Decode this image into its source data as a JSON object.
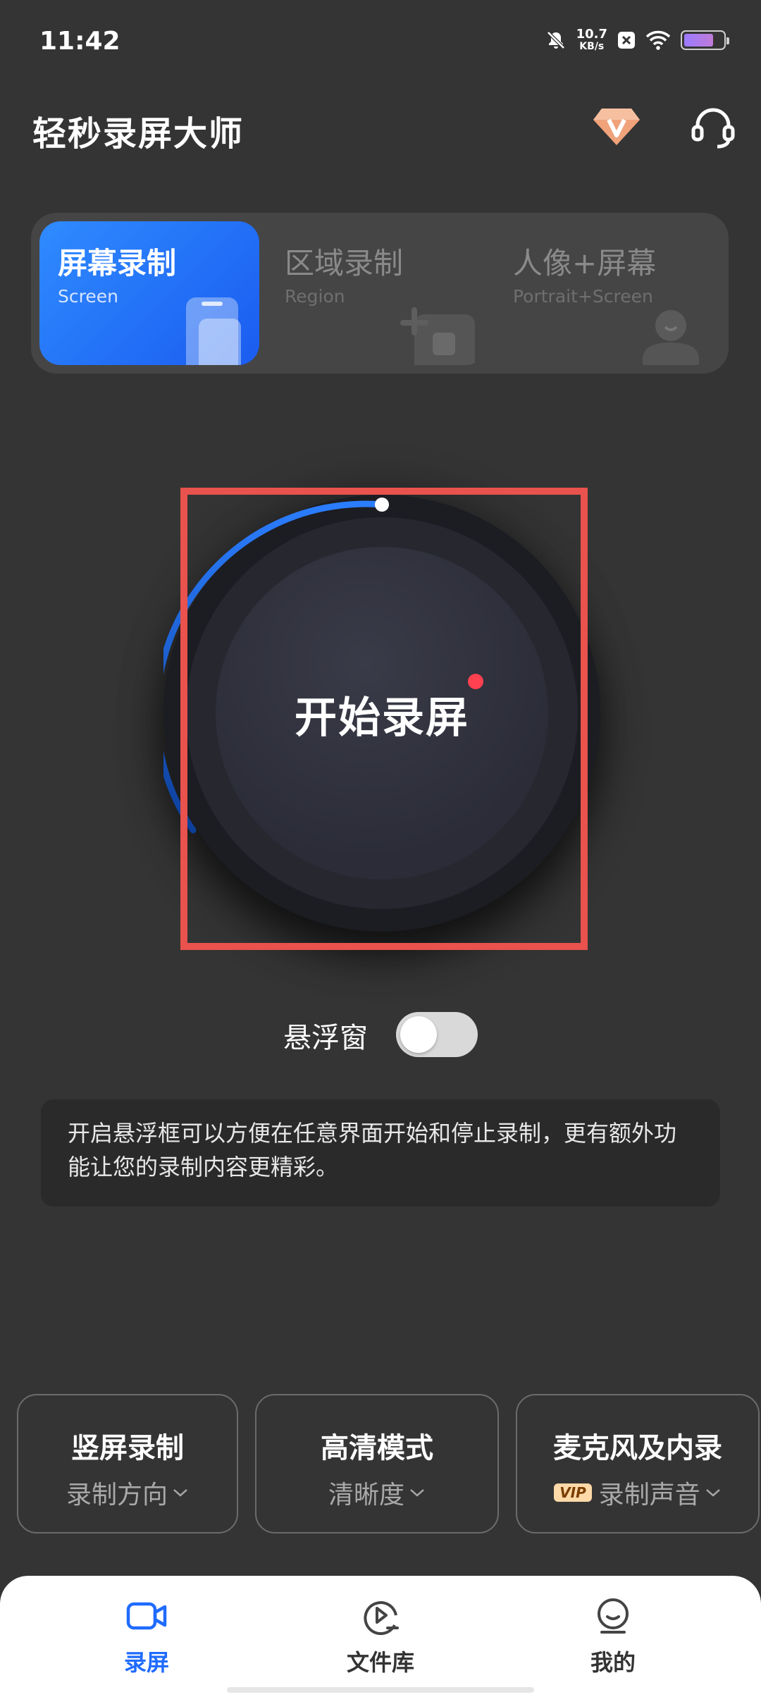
{
  "status_bar": {
    "time": "11:42",
    "net_speed_value": "10.7",
    "net_speed_unit": "KB/s",
    "battery_level": 0.75
  },
  "header": {
    "title": "轻秒录屏大师",
    "vip_icon": "diamond-vip-icon",
    "support_icon": "headset-icon"
  },
  "mode_tabs": [
    {
      "title": "屏幕录制",
      "subtitle": "Screen",
      "active": true
    },
    {
      "title": "区域录制",
      "subtitle": "Region",
      "active": false
    },
    {
      "title": "人像+屏幕",
      "subtitle": "Portrait+Screen",
      "active": false
    }
  ],
  "record_button": {
    "label": "开始录屏"
  },
  "float_window": {
    "label": "悬浮窗",
    "enabled": false,
    "description": "开启悬浮框可以方便在任意界面开始和停止录制，更有额外功能让您的录制内容更精彩。"
  },
  "options": [
    {
      "title": "竖屏录制",
      "subtitle": "录制方向"
    },
    {
      "title": "高清模式",
      "subtitle": "清晰度"
    },
    {
      "title": "麦克风及内录",
      "subtitle": "录制声音",
      "badge": "VIP"
    }
  ],
  "bottom_nav": [
    {
      "label": "录屏",
      "icon": "video-camera-icon",
      "active": true
    },
    {
      "label": "文件库",
      "icon": "play-circle-icon",
      "active": false
    },
    {
      "label": "我的",
      "icon": "profile-icon",
      "active": false
    }
  ],
  "colors": {
    "background": "#343434",
    "accent": "#1f6bff",
    "record_dot": "#ff4150",
    "highlight": "#e9524d"
  }
}
